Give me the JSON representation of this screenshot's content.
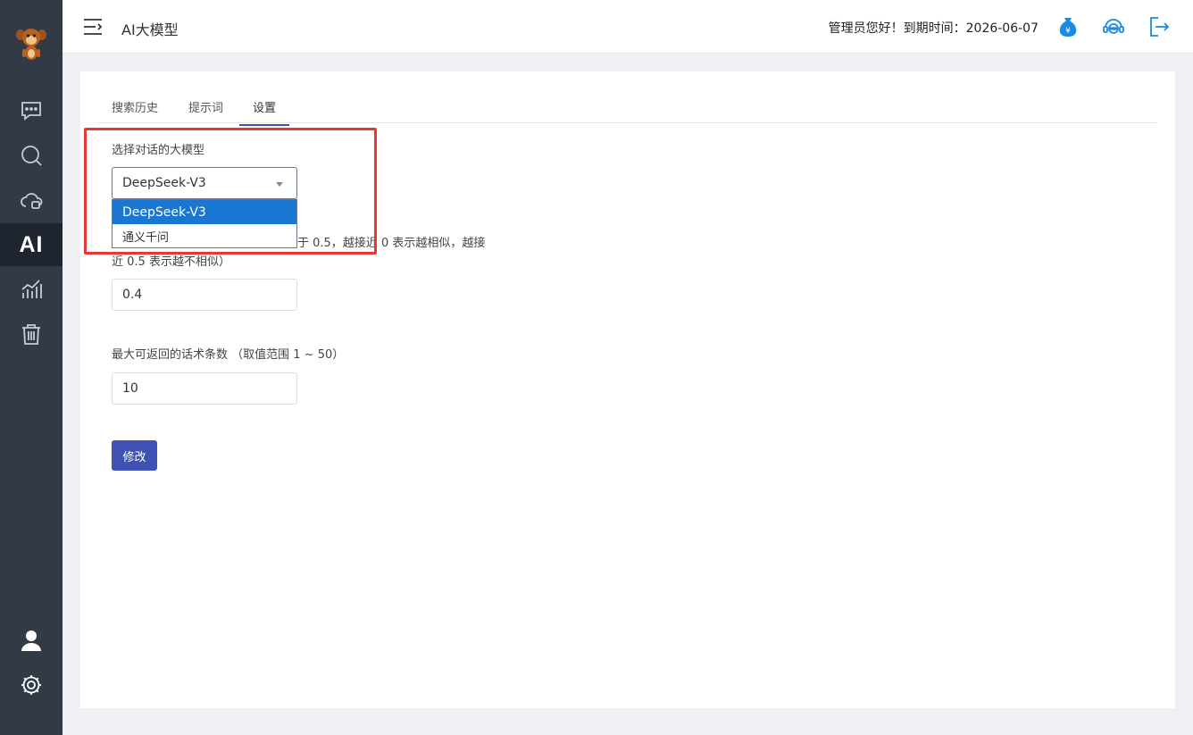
{
  "app": {
    "page_title": "AI大模型",
    "sidebar_ai_label": "AI"
  },
  "header": {
    "greeting": "管理员您好！到期时间：2026-06-07"
  },
  "tabs": [
    {
      "label": "搜索历史",
      "active": false
    },
    {
      "label": "提示词",
      "active": false
    },
    {
      "label": "设置",
      "active": true
    }
  ],
  "settings": {
    "model_label": "选择对话的大模型",
    "model_selected": "DeepSeek-V3",
    "model_options": [
      "DeepSeek-V3",
      "通义千问"
    ],
    "similarity_label_line1": "等于 0.5，越接近 0 表示越相似，越接",
    "similarity_label_line2": "近 0.5 表示越不相似）",
    "similarity_value": "0.4",
    "max_label": "最大可返回的话术条数 （取值范围 1 ~ 50）",
    "max_value": "10",
    "submit_label": "修改"
  },
  "colors": {
    "sidebar": "#323a46",
    "sidebar_active": "#1f252e",
    "primary": "#3f51b5",
    "option_selected": "#1976d2",
    "highlight": "#e53935"
  }
}
